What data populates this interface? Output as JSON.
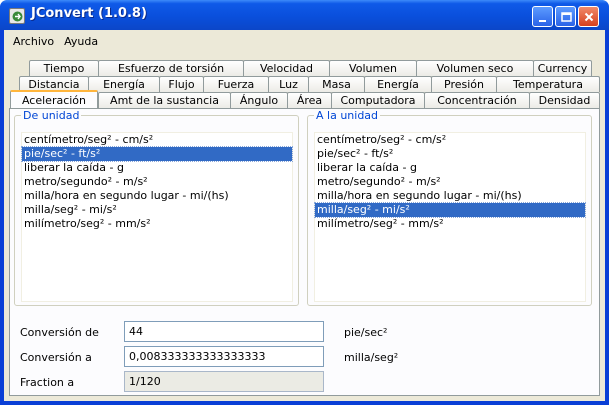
{
  "window": {
    "title": "JConvert (1.0.8)"
  },
  "icons": {
    "app": "app-logo-icon",
    "minimize": "minimize-icon",
    "maximize": "maximize-icon",
    "close": "close-icon"
  },
  "colors": {
    "titlebar": "#0a4fdc",
    "selection": "#316ac5",
    "group_title": "#0046d5",
    "active_tab_accent": "#ffb53c"
  },
  "menu": {
    "items": [
      "Archivo",
      "Ayuda"
    ]
  },
  "tabs": {
    "row1": [
      "Tiempo",
      "Esfuerzo de torsión",
      "Velocidad",
      "Volumen",
      "Volumen seco",
      "Currency"
    ],
    "row2": [
      "Distancia",
      "Energía",
      "Flujo",
      "Fuerza",
      "Luz",
      "Masa",
      "Energía",
      "Presión",
      "Temperatura"
    ],
    "row3": [
      "Aceleración",
      "Amt de la sustancia",
      "Ángulo",
      "Área",
      "Computadora",
      "Concentración",
      "Densidad"
    ],
    "active": "Aceleración"
  },
  "from_unit": {
    "title": "De unidad",
    "items": [
      "centímetro/seg² - cm/s²",
      "pie/sec² - ft/s²",
      "liberar la caída - g",
      "metro/segundo² - m/s²",
      "milla/hora en segundo lugar - mi/(hs)",
      "milla/seg² - mi/s²",
      "milímetro/seg² - mm/s²"
    ],
    "selected": "pie/sec² - ft/s²"
  },
  "to_unit": {
    "title": "A la unidad",
    "items": [
      "centímetro/seg² - cm/s²",
      "pie/sec² - ft/s²",
      "liberar la caída - g",
      "metro/segundo² - m/s²",
      "milla/hora en segundo lugar - mi/(hs)",
      "milla/seg² - mi/s²",
      "milímetro/seg² - mm/s²"
    ],
    "selected": "milla/seg² - mi/s²"
  },
  "conversion": {
    "from_label": "Conversión de",
    "from_value": "44",
    "from_unit": "pie/sec²",
    "to_label": "Conversión a",
    "to_value": "0,008333333333333333",
    "to_unit": "milla/seg²",
    "fraction_label": "Fraction a",
    "fraction_value": "1/120"
  }
}
